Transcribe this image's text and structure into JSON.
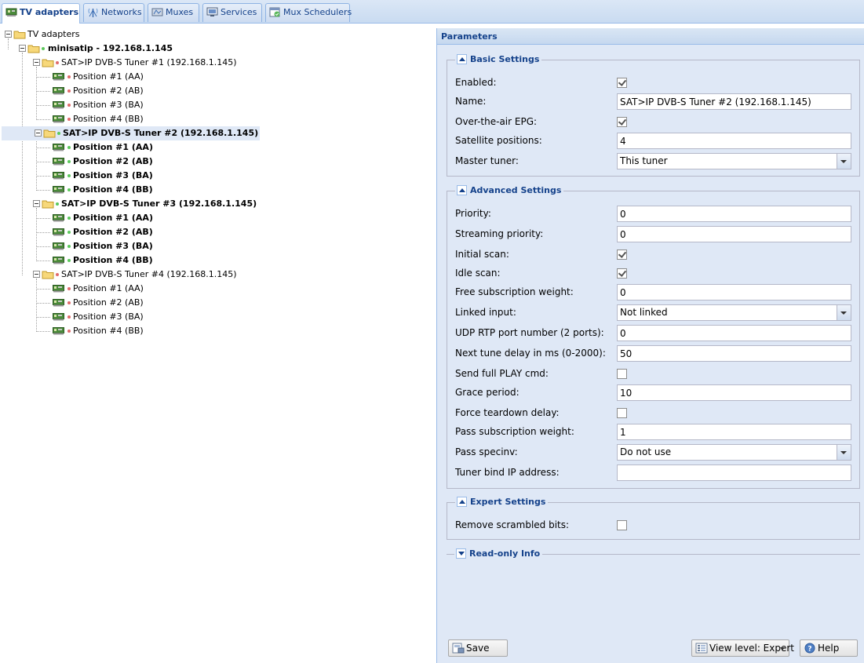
{
  "tabs": [
    {
      "label": "TV adapters",
      "icon": "tv-adapter-icon",
      "active": true
    },
    {
      "label": "Networks",
      "icon": "network-antenna-icon",
      "active": false
    },
    {
      "label": "Muxes",
      "icon": "muxes-icon",
      "active": false
    },
    {
      "label": "Services",
      "icon": "services-tv-icon",
      "active": false
    },
    {
      "label": "Mux Schedulers",
      "icon": "scheduler-calendar-icon",
      "active": false
    }
  ],
  "tree": {
    "root": "TV adapters",
    "server": "minisatip - 192.168.1.145",
    "tuners": [
      {
        "label": "SAT>IP DVB-S Tuner #1 (192.168.1.145)",
        "enabled": false,
        "positions": [
          "Position #1 (AA)",
          "Position #2 (AB)",
          "Position #3 (BA)",
          "Position #4 (BB)"
        ]
      },
      {
        "label": "SAT>IP DVB-S Tuner #2 (192.168.1.145)",
        "enabled": true,
        "selected": true,
        "positions": [
          "Position #1 (AA)",
          "Position #2 (AB)",
          "Position #3 (BA)",
          "Position #4 (BB)"
        ]
      },
      {
        "label": "SAT>IP DVB-S Tuner #3 (192.168.1.145)",
        "enabled": true,
        "positions": [
          "Position #1 (AA)",
          "Position #2 (AB)",
          "Position #3 (BA)",
          "Position #4 (BB)"
        ]
      },
      {
        "label": "SAT>IP DVB-S Tuner #4 (192.168.1.145)",
        "enabled": false,
        "positions": [
          "Position #1 (AA)",
          "Position #2 (AB)",
          "Position #3 (BA)",
          "Position #4 (BB)"
        ]
      }
    ]
  },
  "params": {
    "title": "Parameters",
    "basic": {
      "legend": "Basic Settings",
      "enabled_label": "Enabled:",
      "name_label": "Name:",
      "name_value": "SAT>IP DVB-S Tuner #2 (192.168.1.145)",
      "epg_label": "Over-the-air EPG:",
      "satpos_label": "Satellite positions:",
      "satpos_value": "4",
      "master_label": "Master tuner:",
      "master_value": "This tuner"
    },
    "advanced": {
      "legend": "Advanced Settings",
      "priority_label": "Priority:",
      "priority_value": "0",
      "stream_priority_label": "Streaming priority:",
      "stream_priority_value": "0",
      "initial_scan_label": "Initial scan:",
      "idle_scan_label": "Idle scan:",
      "free_sub_label": "Free subscription weight:",
      "free_sub_value": "0",
      "linked_label": "Linked input:",
      "linked_value": "Not linked",
      "udp_label": "UDP RTP port number (2 ports):",
      "udp_value": "0",
      "next_tune_label": "Next tune delay in ms (0-2000):",
      "next_tune_value": "50",
      "full_play_label": "Send full PLAY cmd:",
      "grace_label": "Grace period:",
      "grace_value": "10",
      "teardown_label": "Force teardown delay:",
      "pass_sub_label": "Pass subscription weight:",
      "pass_sub_value": "1",
      "specinv_label": "Pass specinv:",
      "specinv_value": "Do not use",
      "bind_ip_label": "Tuner bind IP address:",
      "bind_ip_value": ""
    },
    "expert": {
      "legend": "Expert Settings",
      "scrambled_label": "Remove scrambled bits:"
    },
    "readonly": {
      "legend": "Read-only Info"
    }
  },
  "buttons": {
    "save": "Save",
    "view_level": "View level: Expert",
    "help": "Help"
  },
  "colors": {
    "status_enabled": "#5cc85c",
    "status_disabled": "#e06a6a",
    "panel_bg": "#dfe8f6",
    "header_text": "#15428b"
  }
}
